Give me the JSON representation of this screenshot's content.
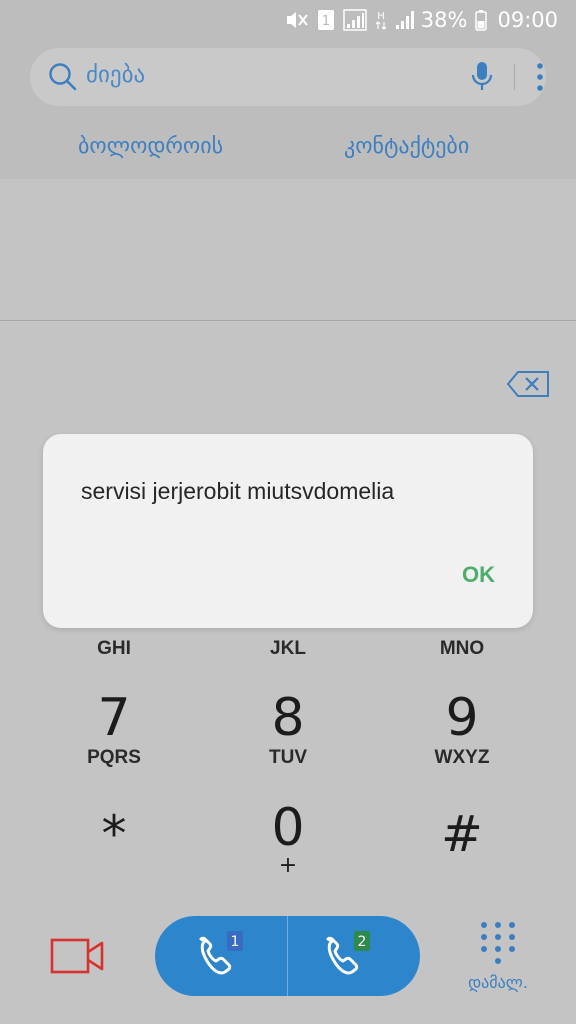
{
  "status_bar": {
    "battery": "38%",
    "time": "09:00",
    "icons": [
      "mute-vibrate-icon",
      "sim-1-icon",
      "signal-sim1-icon",
      "data-h-icon",
      "signal-sim2-icon",
      "battery-icon"
    ],
    "sim_badge": "1",
    "data_type": "H"
  },
  "search": {
    "placeholder": "ძიება",
    "icons": [
      "search-icon",
      "microphone-icon",
      "more-options-icon"
    ]
  },
  "tabs": {
    "recent": "ბოლოდროის",
    "contacts": "კონტაქტები"
  },
  "dialog": {
    "message": "servisi jerjerobit miutsvdomelia",
    "ok_label": "OK"
  },
  "keypad": {
    "row3_letters": [
      "GHI",
      "JKL",
      "MNO"
    ],
    "rows": [
      {
        "digit": "7",
        "letters": "PQRS"
      },
      {
        "digit": "8",
        "letters": "TUV"
      },
      {
        "digit": "9",
        "letters": "WXYZ"
      }
    ],
    "star": "*",
    "zero": "0",
    "plus": "+",
    "hash": "#"
  },
  "actions": {
    "sim1_badge": "1",
    "sim2_badge": "2",
    "hide_keypad_label": "დამალ.",
    "colors": {
      "accent": "#2d86cc",
      "video": "#d8322f",
      "ok": "#4cae6a",
      "sim1": "#3a6bc2",
      "sim2": "#2e8a4a"
    }
  }
}
